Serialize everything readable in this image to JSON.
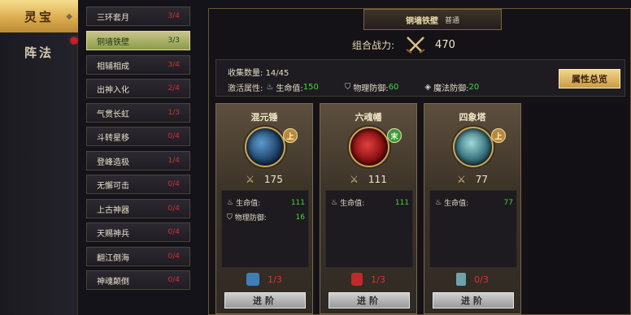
{
  "tabs": [
    {
      "label": "灵宝",
      "active": true
    },
    {
      "label": "阵法",
      "active": false
    }
  ],
  "sets": [
    {
      "name": "三环套月",
      "count": "3/4"
    },
    {
      "name": "铜墙铁壁",
      "count": "3/3",
      "selected": true
    },
    {
      "name": "相辅相成",
      "count": "3/4"
    },
    {
      "name": "出神入化",
      "count": "2/4"
    },
    {
      "name": "气贯长虹",
      "count": "1/3"
    },
    {
      "name": "斗转星移",
      "count": "0/4"
    },
    {
      "name": "登峰造极",
      "count": "1/4"
    },
    {
      "name": "无懈可击",
      "count": "0/4"
    },
    {
      "name": "上古神器",
      "count": "0/4"
    },
    {
      "name": "天赐神兵",
      "count": "0/4"
    },
    {
      "name": "翻江倒海",
      "count": "0/4"
    },
    {
      "name": "神魂颠倒",
      "count": "0/4"
    }
  ],
  "panel": {
    "title": "铜墙铁壁",
    "quality": "普通",
    "power_label": "组合战力:",
    "power_value": "470",
    "collect_label": "收集数量:",
    "collect_value": "14/45",
    "activate_label": "激活属性:",
    "attrs": [
      {
        "icon": "flame-icon",
        "label": "生命值:",
        "value": "150"
      },
      {
        "icon": "shield-icon",
        "label": "物理防御:",
        "value": "60"
      },
      {
        "icon": "magic-shield-icon",
        "label": "魔法防御:",
        "value": "20"
      }
    ],
    "summary_button": "属性总览"
  },
  "cards": [
    {
      "name": "混元锤",
      "grade": "上",
      "grade_color": "#b68a3a",
      "power": "175",
      "orb_color": "#2f5f8f",
      "stats": [
        {
          "icon": "flame-icon",
          "label": "生命值:",
          "value": "111"
        },
        {
          "icon": "shield-icon",
          "label": "物理防御:",
          "value": "16"
        }
      ],
      "fragments": "1/3",
      "button": "进阶"
    },
    {
      "name": "六魂幡",
      "grade": "末",
      "grade_color": "#3a9a3a",
      "power": "111",
      "orb_color": "#b02020",
      "stats": [
        {
          "icon": "flame-icon",
          "label": "生命值:",
          "value": "111"
        }
      ],
      "fragments": "1/3",
      "button": "进阶"
    },
    {
      "name": "四象塔",
      "grade": "上",
      "grade_color": "#b68a3a",
      "power": "77",
      "orb_color": "#3f7a84",
      "stats": [
        {
          "icon": "flame-icon",
          "label": "生命值:",
          "value": "77"
        }
      ],
      "fragments": "0/3",
      "button": "进阶"
    }
  ]
}
